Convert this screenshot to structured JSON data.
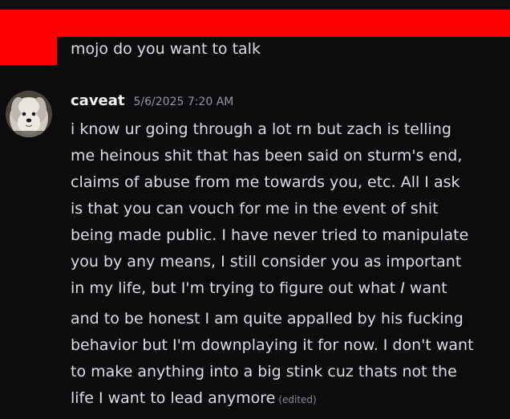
{
  "previous_message": {
    "text": "mojo do you want to talk"
  },
  "message": {
    "username": "caveat",
    "timestamp": "5/6/2025 7:20 AM",
    "lines_before_gap": [
      "i know ur going through a lot rn but zach is telling",
      "me heinous shit that has been said on sturm's end,",
      "claims of abuse from me towards you, etc. All I ask",
      "is that you can vouch for me in the event of shit",
      "being made public. I have never tried to manipulate",
      "you by any means, I still consider you as important",
      "in my life, but I'm trying to figure out what "
    ],
    "emphasis_word": "I",
    "line7_tail": " want",
    "lines_after_gap": [
      "and to be honest I am quite appalled by his fucking",
      "behavior but I'm downplaying it for now. I don't want",
      "to make anything into a big stink cuz thats not the"
    ],
    "last_line": "life I want to lead anymore",
    "edited_label": "(edited)"
  },
  "colors": {
    "background": "#0c0c0f",
    "redaction": "#ff0000",
    "text": "#dcdde1",
    "username": "#f2f3f5",
    "timestamp": "#94959c"
  },
  "icons": {
    "avatar": "fluffy-dog-avatar-icon"
  }
}
